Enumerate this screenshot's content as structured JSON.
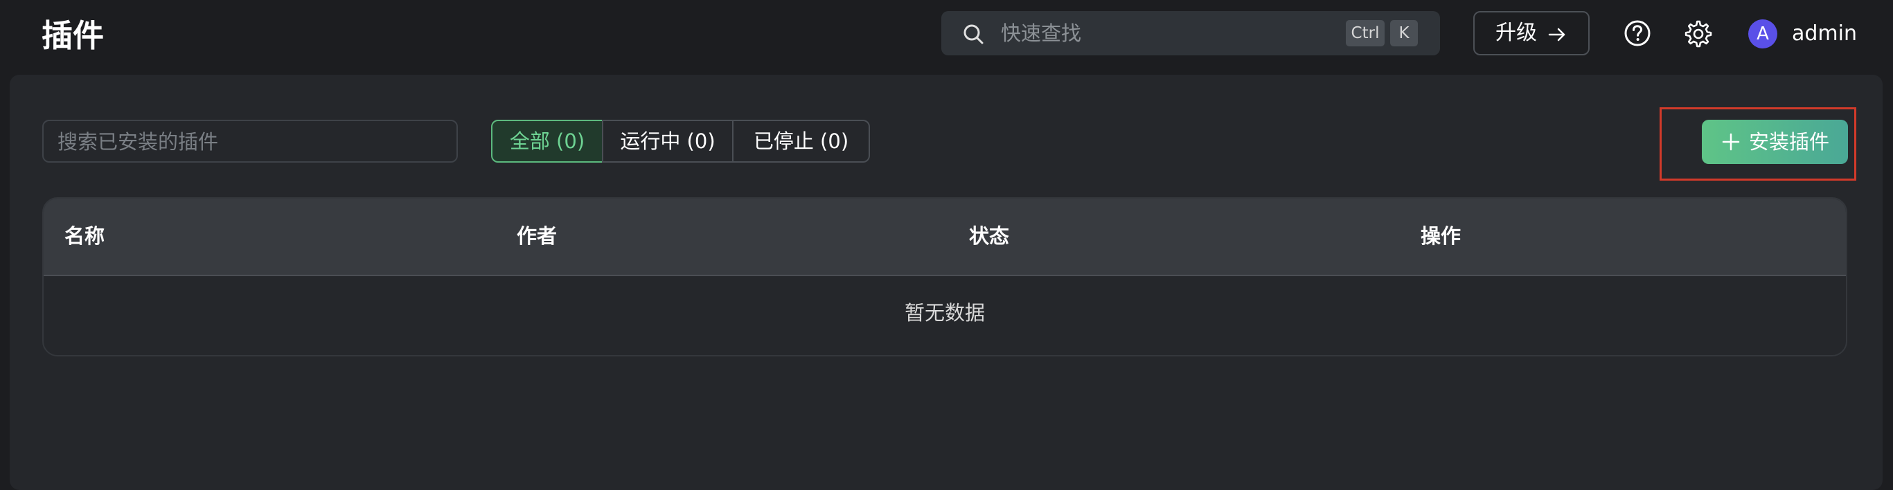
{
  "header": {
    "title": "插件",
    "search_placeholder": "快速查找",
    "shortcut_keys": [
      "Ctrl",
      "K"
    ],
    "upgrade_label": "升级",
    "avatar_letter": "A",
    "username": "admin"
  },
  "toolbar": {
    "search_placeholder": "搜索已安装的插件",
    "filters": [
      {
        "label": "全部 (0)",
        "active": true
      },
      {
        "label": "运行中 (0)",
        "active": false
      },
      {
        "label": "已停止 (0)",
        "active": false
      }
    ],
    "install_label": "安装插件"
  },
  "table": {
    "columns": [
      "名称",
      "作者",
      "状态",
      "操作"
    ],
    "rows": [],
    "empty_text": "暂无数据"
  },
  "colors": {
    "accent_green": "#5fc487",
    "avatar": "#5a50e8",
    "highlight_outline": "#d23a2a"
  },
  "icons": [
    "search-icon",
    "arrow-right-icon",
    "help-icon",
    "gear-icon",
    "plus-icon"
  ]
}
